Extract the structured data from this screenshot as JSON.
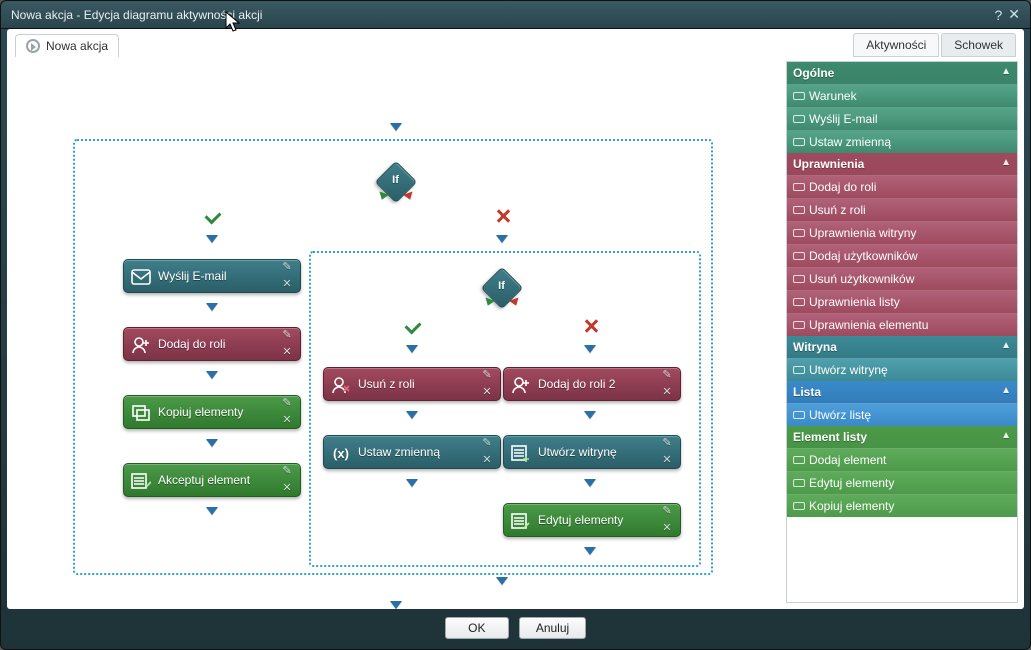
{
  "window": {
    "title": "Nowa akcja - Edycja diagramu aktywności akcji"
  },
  "tabs": {
    "main": "Nowa akcja",
    "right_active": "Aktywności",
    "right_inactive": "Schowek"
  },
  "canvas": {
    "if1": "If",
    "if2": "If",
    "left_col": {
      "email": "Wyślij E-mail",
      "add_role": "Dodaj do roli",
      "copy": "Kopiuj elementy",
      "accept": "Akceptuj element"
    },
    "mid_col": {
      "remove_role": "Usuń z roli",
      "set_var": "Ustaw zmienną"
    },
    "right_col_inner": {
      "add_role2": "Dodaj do roli 2",
      "create_site": "Utwórz witrynę",
      "edit": "Edytuj elementy"
    }
  },
  "palette": {
    "general": {
      "head": "Ogólne",
      "items": [
        "Warunek",
        "Wyślij E-mail",
        "Ustaw zmienną"
      ]
    },
    "perm": {
      "head": "Uprawnienia",
      "items": [
        "Dodaj do roli",
        "Usuń z roli",
        "Uprawnienia witryny",
        "Dodaj użytkowników",
        "Usuń użytkowników",
        "Uprawnienia listy",
        "Uprawnienia elementu"
      ]
    },
    "site": {
      "head": "Witryna",
      "items": [
        "Utwórz witrynę"
      ]
    },
    "list": {
      "head": "Lista",
      "items": [
        "Utwórz listę"
      ]
    },
    "elem": {
      "head": "Element listy",
      "items": [
        "Dodaj element",
        "Edytuj elementy",
        "Kopiuj elementy"
      ]
    }
  },
  "footer": {
    "ok": "OK",
    "cancel": "Anuluj"
  }
}
